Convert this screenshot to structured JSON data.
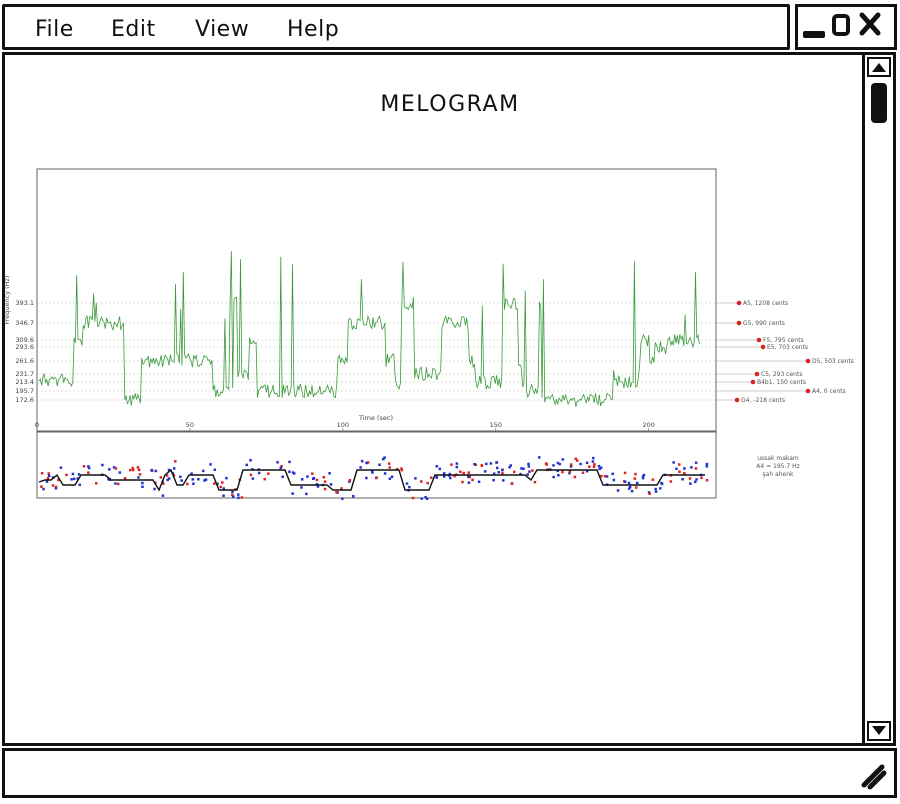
{
  "menu": {
    "items": [
      {
        "label": "File"
      },
      {
        "label": "Edit"
      },
      {
        "label": "View"
      },
      {
        "label": "Help"
      }
    ]
  },
  "window_controls": {
    "icons": [
      "minimize-icon",
      "maximize-icon",
      "close-icon"
    ]
  },
  "page": {
    "title": "MELOGRAM"
  },
  "scrollbar": {
    "up_icon": "arrow-up-icon",
    "down_icon": "arrow-down-icon"
  },
  "statusbar": {
    "resize_icon": "resize-grip-icon"
  },
  "chart_data": {
    "type": "line",
    "title": "",
    "xlabel": "Time (sec)",
    "ylabel": "Frequency (Hz)",
    "xlim": [
      0,
      222
    ],
    "x_ticks": [
      "0",
      "50",
      "100",
      "150",
      "200"
    ],
    "y_ticks": [
      "393.1",
      "346.7",
      "309.6",
      "293.6",
      "261.6",
      "231.7",
      "213.4",
      "195.7",
      "172.6"
    ],
    "note_labels": [
      {
        "freq": 393.1,
        "label": "A5, 1208 cents"
      },
      {
        "freq": 346.7,
        "label": "G5, 990 cents"
      },
      {
        "freq": 309.6,
        "label": "F5, 795 cents"
      },
      {
        "freq": 293.6,
        "label": "E5, 703 cents"
      },
      {
        "freq": 261.6,
        "label": "D5, 503 cents"
      },
      {
        "freq": 231.7,
        "label": "C5, 293 cents"
      },
      {
        "freq": 213.4,
        "label": "B4b1, 150 cents"
      },
      {
        "freq": 195.7,
        "label": "A4, 0 cents"
      },
      {
        "freq": 172.6,
        "label": "G4, -218 cents"
      }
    ],
    "series": [
      {
        "color": "#3a9a3a"
      }
    ],
    "lower_panel": {
      "path_color": "#111111",
      "dot_colors": [
        "#2233cc",
        "#dd2222"
      ]
    },
    "annotation": [
      "ussak makam",
      "A4 = 195.7 Hz",
      "şah ahenk"
    ],
    "grid": true
  }
}
